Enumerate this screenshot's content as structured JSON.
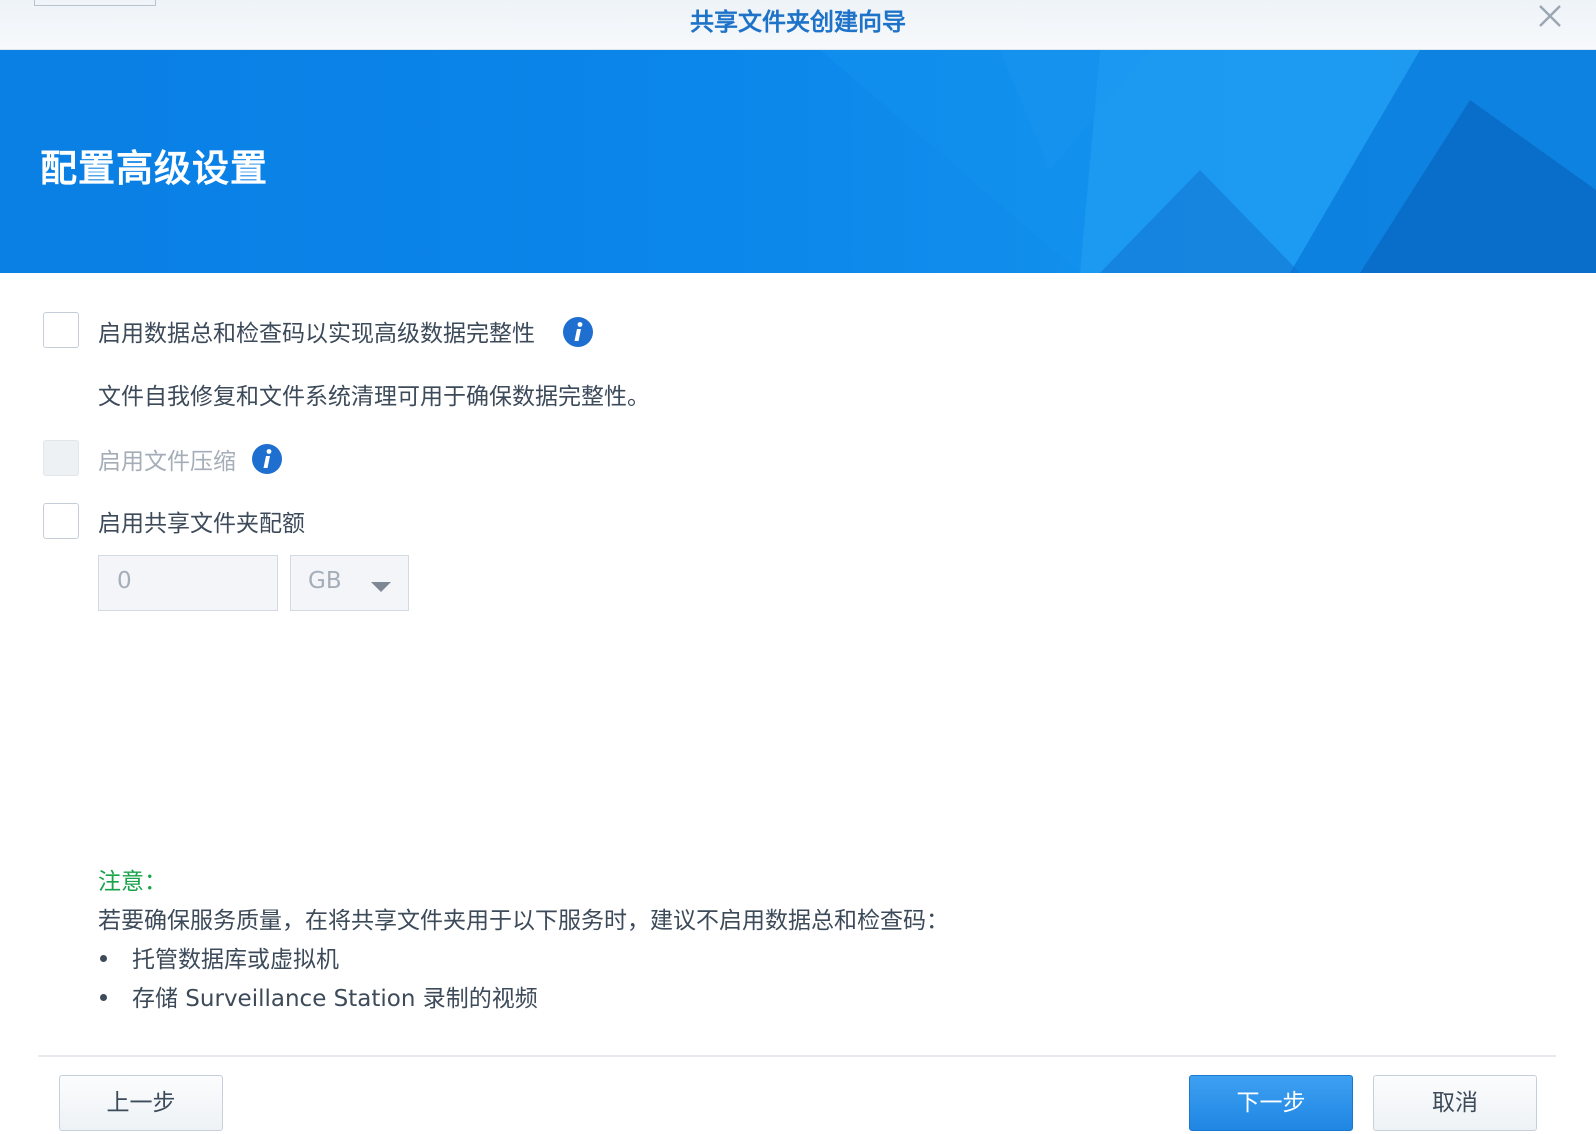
{
  "window": {
    "title": "共享文件夹创建向导"
  },
  "banner": {
    "heading": "配置高级设置"
  },
  "options": {
    "checksum": {
      "label": "启用数据总和检查码以实现高级数据完整性",
      "checked": false,
      "description": "文件自我修复和文件系统清理可用于确保数据完整性。"
    },
    "compression": {
      "label": "启用文件压缩",
      "checked": false,
      "disabled": true
    },
    "quota": {
      "label": "启用共享文件夹配额",
      "checked": false,
      "value": "0",
      "unit": "GB"
    }
  },
  "note": {
    "title": "注意：",
    "text": "若要确保服务质量，在将共享文件夹用于以下服务时，建议不启用数据总和检查码：",
    "items": [
      "托管数据库或虚拟机",
      "存储 Surveillance Station 录制的视频"
    ]
  },
  "footer": {
    "back_label": "上一步",
    "next_label": "下一步",
    "cancel_label": "取消"
  },
  "colors": {
    "banner": "#0b86ea",
    "primary_button": "#2a8fe8",
    "note_title": "#19a34a",
    "info_icon": "#1f6fd1"
  },
  "icons": [
    "close-icon",
    "info-icon",
    "chevron-down-icon"
  ]
}
